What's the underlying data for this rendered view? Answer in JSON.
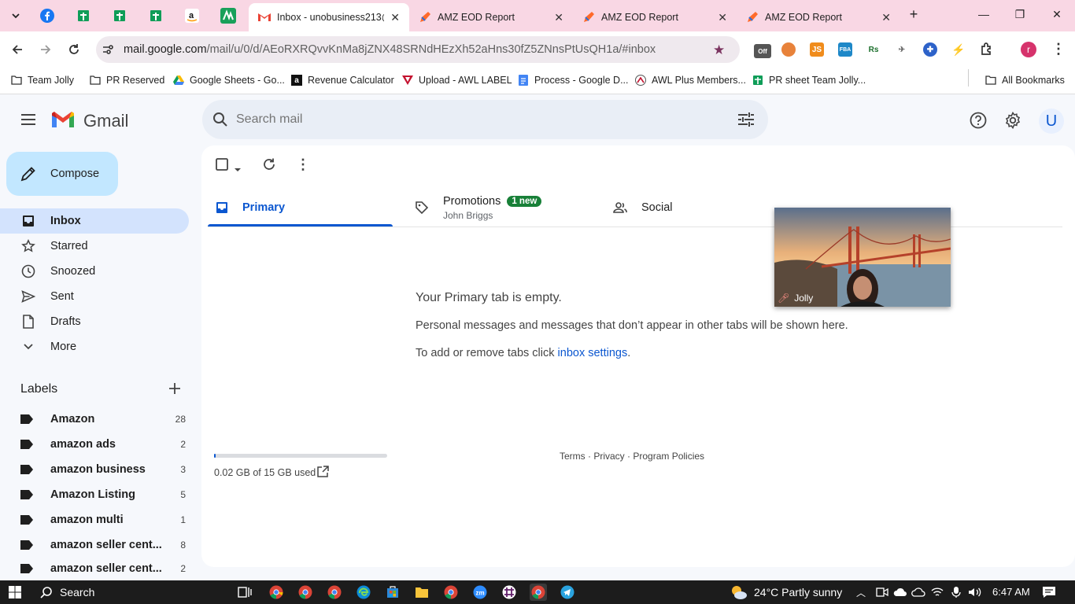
{
  "browser": {
    "tabs": [
      {
        "title": "Inbox - unobusiness213@",
        "active": true
      },
      {
        "title": "AMZ EOD Report",
        "active": false
      },
      {
        "title": "AMZ EOD Report",
        "active": false
      },
      {
        "title": "AMZ EOD Report",
        "active": false
      }
    ],
    "url_host": "mail.google.com",
    "url_path": "/mail/u/0/d/AEoRXRQvvKnMa8jZNX48SRNdHEzXh52aHns30fZ5ZNnsPtUsQH1a/#inbox",
    "profile_initial": "r",
    "bookmarks": [
      "Team Jolly",
      "PR Reserved",
      "Google Sheets - Go...",
      "Revenue Calculator",
      "Upload - AWL LABEL",
      "Process - Google D...",
      "AWL Plus Members...",
      "PR sheet Team Jolly..."
    ],
    "all_bookmarks": "All Bookmarks",
    "extension_labels": {
      "js": "JS",
      "fba": "FBA",
      "rs": "Rs",
      "off": "Off"
    }
  },
  "gmail": {
    "logo_text": "Gmail",
    "search_placeholder": "Search mail",
    "account_initial": "U",
    "compose": "Compose",
    "nav": [
      {
        "label": "Inbox",
        "icon": "inbox-icon"
      },
      {
        "label": "Starred",
        "icon": "star-icon"
      },
      {
        "label": "Snoozed",
        "icon": "clock-icon"
      },
      {
        "label": "Sent",
        "icon": "send-icon"
      },
      {
        "label": "Drafts",
        "icon": "draft-icon"
      },
      {
        "label": "More",
        "icon": "chevron-down-icon"
      }
    ],
    "labels_heading": "Labels",
    "labels": [
      {
        "name": "Amazon",
        "count": "28"
      },
      {
        "name": "amazon ads",
        "count": "2"
      },
      {
        "name": "amazon business",
        "count": "3"
      },
      {
        "name": "Amazon Listing",
        "count": "5"
      },
      {
        "name": "amazon multi",
        "count": "1"
      },
      {
        "name": "amazon seller cent...",
        "count": "8"
      },
      {
        "name": "amazon seller cent...",
        "count": "2"
      }
    ],
    "category_tabs": {
      "primary": "Primary",
      "promotions": "Promotions",
      "promotions_badge": "1 new",
      "promotions_sender": "John Briggs",
      "social": "Social"
    },
    "empty": {
      "heading": "Your Primary tab is empty.",
      "line1": "Personal messages and messages that don’t appear in other tabs will be shown here.",
      "line2_prefix": "To add or remove tabs click ",
      "line2_link": "inbox settings",
      "line2_suffix": "."
    },
    "storage": {
      "text": "0.02 GB of 15 GB used",
      "fraction": 0.0013
    },
    "footer": {
      "terms": "Terms",
      "privacy": "Privacy",
      "policies": "Program Policies",
      "sep": " · "
    },
    "video_name": "Jolly"
  },
  "taskbar": {
    "search": "Search",
    "weather": "24°C  Partly sunny",
    "time": "6:47 AM"
  },
  "colors": {
    "accent": "#0b57d0",
    "badge": "#188038",
    "tabbar": "#f9d7e4",
    "nav_active": "#d3e3fd"
  }
}
